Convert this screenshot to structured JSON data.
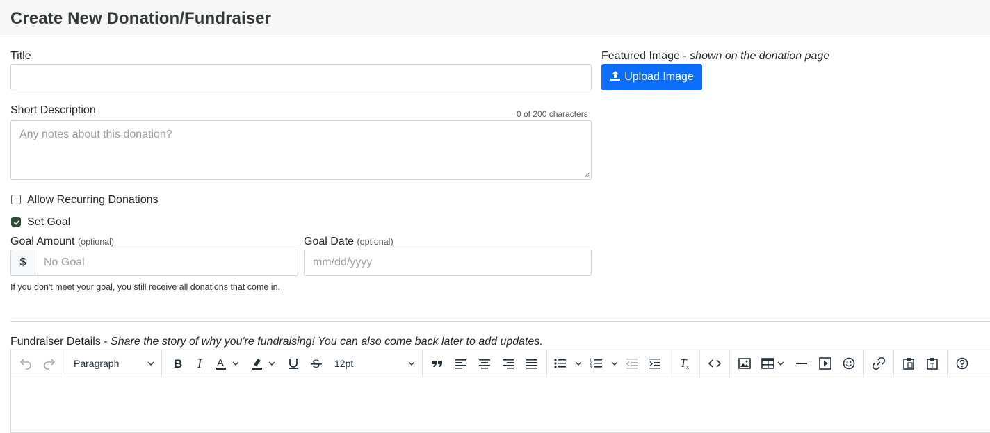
{
  "header": {
    "title": "Create New Donation/Fundraiser"
  },
  "form": {
    "title_label": "Title",
    "title_value": "",
    "image_label": "Featured Image",
    "image_sep": " - ",
    "image_hint": "shown on the donation page",
    "upload_label": "Upload Image",
    "short_desc_label": "Short Description",
    "short_desc_counter": "0 of 200 characters",
    "short_desc_placeholder": "Any notes about this donation?",
    "recurring_label": "Allow Recurring Donations",
    "recurring_checked": false,
    "set_goal_label": "Set Goal",
    "set_goal_checked": true,
    "goal_amount_label": "Goal Amount",
    "optional_text": "(optional)",
    "currency_symbol": "$",
    "goal_amount_placeholder": "No Goal",
    "goal_date_label": "Goal Date",
    "goal_date_placeholder": "mm/dd/yyyy",
    "goal_help": "If you don't meet your goal, you still receive all donations that come in."
  },
  "details": {
    "label": "Fundraiser Details",
    "sep": " - ",
    "hint": "Share the story of why you're fundraising! You can also come back later to add updates."
  },
  "editor": {
    "block_format": "Paragraph",
    "font_size": "12pt",
    "icons": [
      "undo-icon",
      "redo-icon",
      "bold-icon",
      "italic-icon",
      "text-color-icon",
      "highlight-icon",
      "underline-icon",
      "strikethrough-icon",
      "blockquote-icon",
      "align-left-icon",
      "align-center-icon",
      "align-right-icon",
      "align-justify-icon",
      "bullet-list-icon",
      "numbered-list-icon",
      "outdent-icon",
      "indent-icon",
      "clear-format-icon",
      "code-icon",
      "image-icon",
      "table-icon",
      "horizontal-rule-icon",
      "media-icon",
      "emoticon-icon",
      "link-icon",
      "paste-icon",
      "paste-text-icon",
      "help-icon"
    ]
  },
  "colors": {
    "primary": "#0d6efd",
    "checked": "#2f4b3a",
    "border": "#ced4da",
    "header_bg": "#f7f7f7"
  }
}
